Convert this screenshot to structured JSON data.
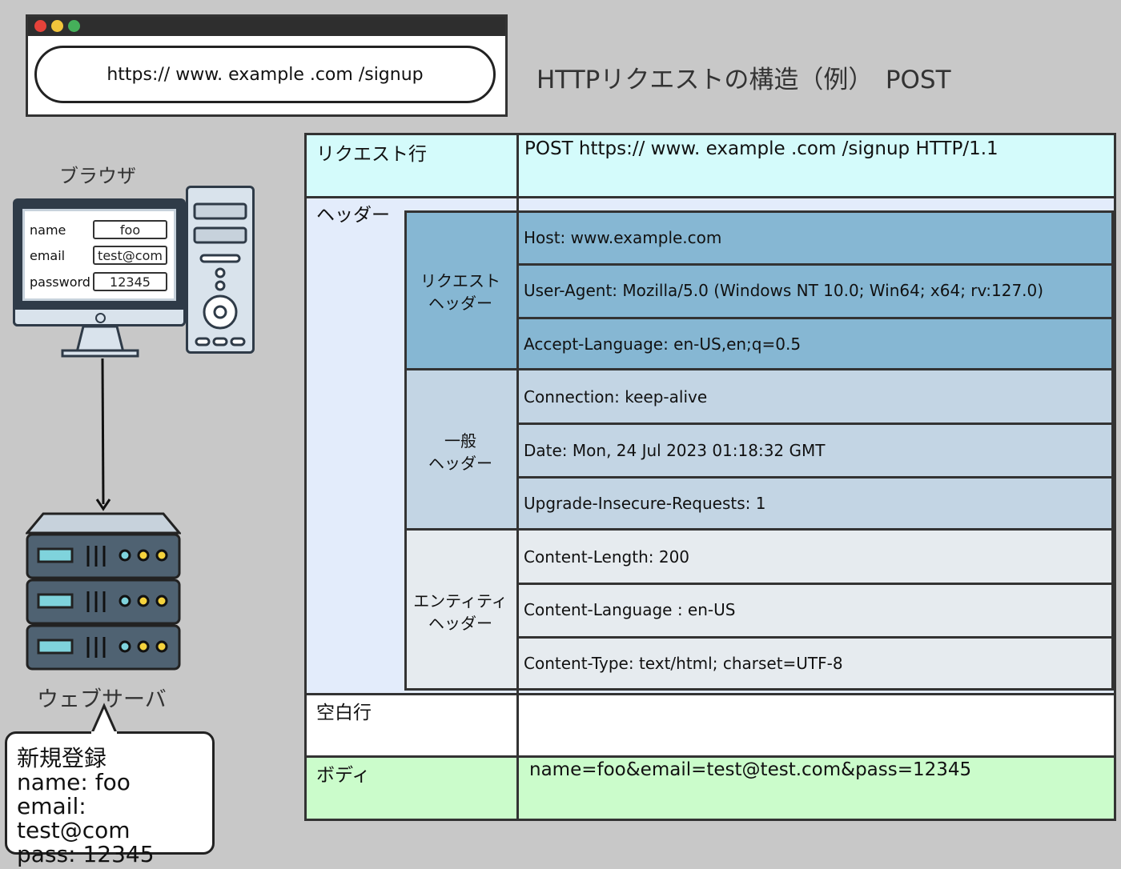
{
  "browser_window": {
    "url": "https://  www. example .com /signup",
    "dot_colors": [
      "#e5423a",
      "#f2c53b",
      "#45b05a"
    ]
  },
  "title": "HTTPリクエストの構造（例）　POST",
  "browser_label": "ブラウザ",
  "form": {
    "name_label": "name",
    "name_value": "foo",
    "email_label": "email",
    "email_value": "test@com",
    "password_label": "password",
    "password_value": "12345"
  },
  "server_label": "ウェブサーバ",
  "bubble": {
    "title": "新規登録",
    "line1": "name: foo",
    "line2": "email: test@com",
    "line3": "pass: 12345"
  },
  "table": {
    "request_line_label": "リクエスト行",
    "request_line_value": "POST https://  www. example .com /signup HTTP/1.1",
    "header_label": "ヘッダー",
    "request_header_label": [
      "リクエスト",
      "ヘッダー"
    ],
    "request_headers": [
      "Host: www.example.com",
      "User-Agent: Mozilla/5.0 (Windows NT 10.0; Win64; x64; rv:127.0)",
      "Accept-Language: en-US,en;q=0.5"
    ],
    "general_header_label": [
      "一般",
      "ヘッダー"
    ],
    "general_headers": [
      "Connection: keep-alive",
      "Date: Mon, 24 Jul 2023 01:18:32 GMT",
      "Upgrade-Insecure-Requests: 1"
    ],
    "entity_header_label": [
      "エンティティ",
      "ヘッダー"
    ],
    "entity_headers": [
      "Content-Length: 200",
      "Content-Language : en-US",
      "Content-Type: text/html; charset=UTF-8"
    ],
    "blank_line_label": "空白行",
    "body_label": "ボディ",
    "body_value": "name=foo&email=test@test.com&pass=12345"
  },
  "colors": {
    "request_line_bg": "#d4fbfb",
    "header_bg": "#e3ecfb",
    "request_header_bg": "#86b7d3",
    "general_header_bg": "#c3d5e4",
    "entity_header_bg": "#e6ebef",
    "body_bg": "#cbfccb"
  }
}
